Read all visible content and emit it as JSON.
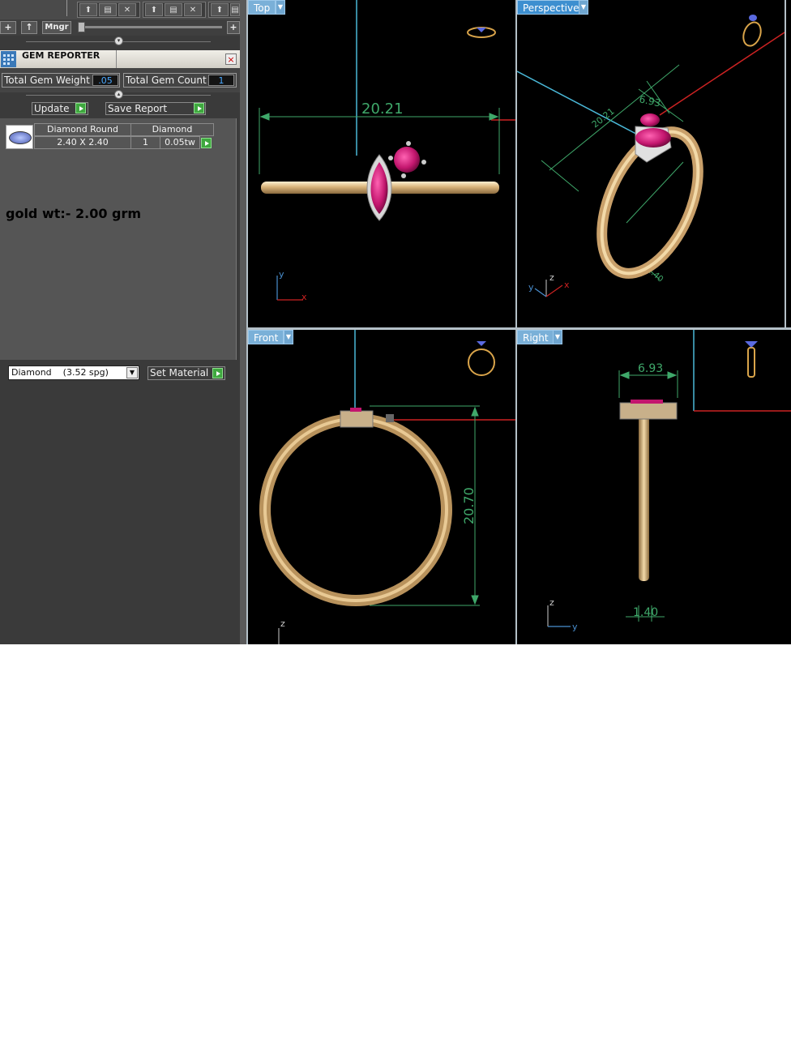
{
  "toolbar": {
    "add_label": "+",
    "up_label": "↑",
    "mngr_label": "Mngr",
    "slider_plus": "+"
  },
  "gem_reporter": {
    "title": "GEM REPORTER",
    "close_label": "×",
    "total_weight_label": "Total Gem Weight",
    "total_weight_value": ".05",
    "total_count_label": "Total Gem Count",
    "total_count_value": "1",
    "update_label": "Update",
    "save_report_label": "Save Report",
    "gems": [
      {
        "shape": "Diamond Round",
        "size": "2.40 X 2.40",
        "material": "Diamond",
        "count": "1",
        "weight": "0.05tw"
      }
    ],
    "note": "gold wt:- 2.00 grm"
  },
  "material": {
    "selected": "Diamond    (3.52 spg)",
    "set_label": "Set Material"
  },
  "viewports": {
    "top": {
      "label": "Top",
      "dimension": "20.21"
    },
    "perspective": {
      "label": "Perspective",
      "dim_a": "6.93",
      "dim_b": "20.21",
      "dim_c": "1.40"
    },
    "front": {
      "label": "Front",
      "dimension": "20.70"
    },
    "right": {
      "label": "Right",
      "dim_top": "6.93",
      "dim_bottom": "1.40"
    }
  },
  "axes": {
    "x": "x",
    "y": "y",
    "z": "z"
  },
  "colors": {
    "gold": "#d9b47a",
    "gem": "#c3166e",
    "dimension": "#3fa86a",
    "viewport_label": "#7ab0d8"
  }
}
